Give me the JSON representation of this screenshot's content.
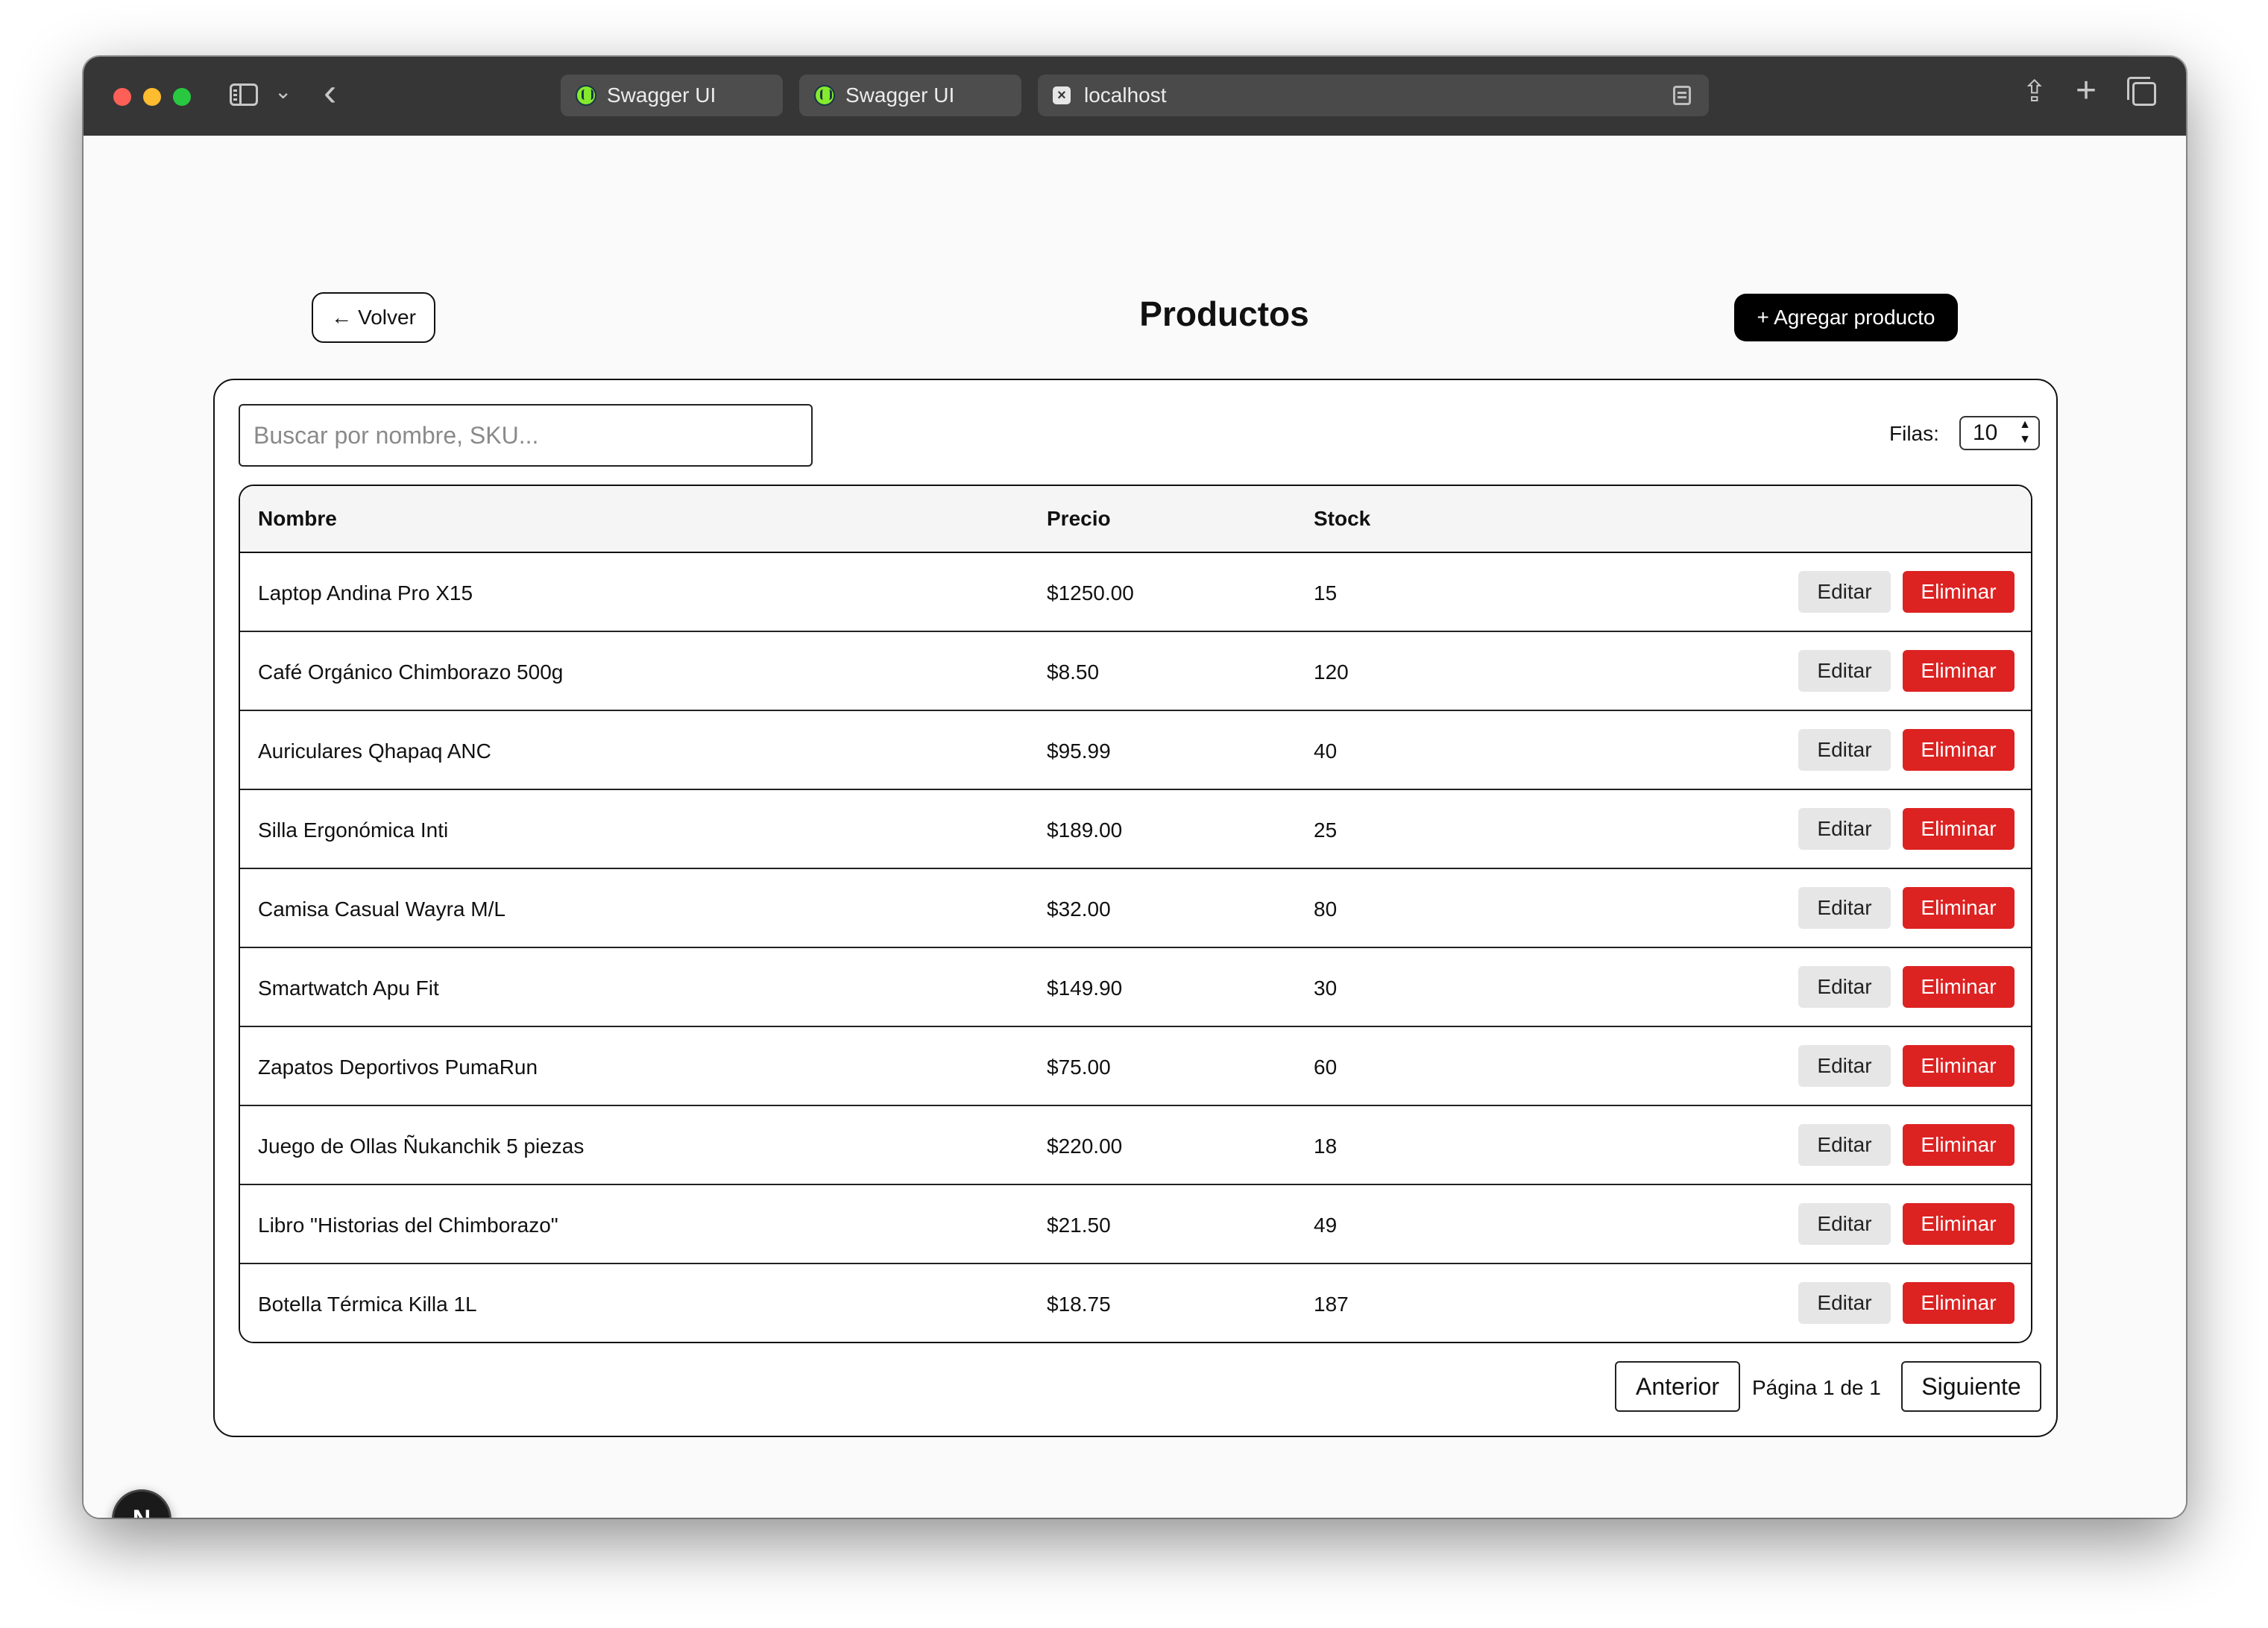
{
  "browser": {
    "tabs": [
      {
        "label": "Swagger UI"
      },
      {
        "label": "Swagger UI"
      },
      {
        "label": "localhost"
      }
    ]
  },
  "header": {
    "back_label": "Volver",
    "title": "Productos",
    "add_label": "+ Agregar producto"
  },
  "search": {
    "placeholder": "Buscar por nombre, SKU..."
  },
  "rows_control": {
    "label": "Filas:",
    "value": "10"
  },
  "table": {
    "columns": [
      "Nombre",
      "Precio",
      "Stock"
    ],
    "rows": [
      {
        "name": "Laptop Andina Pro X15",
        "price": "$1250.00",
        "stock": "15"
      },
      {
        "name": "Café Orgánico Chimborazo 500g",
        "price": "$8.50",
        "stock": "120"
      },
      {
        "name": "Auriculares Qhapaq ANC",
        "price": "$95.99",
        "stock": "40"
      },
      {
        "name": "Silla Ergonómica Inti",
        "price": "$189.00",
        "stock": "25"
      },
      {
        "name": "Camisa Casual Wayra M/L",
        "price": "$32.00",
        "stock": "80"
      },
      {
        "name": "Smartwatch Apu Fit",
        "price": "$149.90",
        "stock": "30"
      },
      {
        "name": "Zapatos Deportivos PumaRun",
        "price": "$75.00",
        "stock": "60"
      },
      {
        "name": "Juego de Ollas Ñukanchik 5 piezas",
        "price": "$220.00",
        "stock": "18"
      },
      {
        "name": "Libro \"Historias del Chimborazo\"",
        "price": "$21.50",
        "stock": "49"
      },
      {
        "name": "Botella Térmica Killa 1L",
        "price": "$18.75",
        "stock": "187"
      }
    ],
    "edit_label": "Editar",
    "delete_label": "Eliminar"
  },
  "pagination": {
    "prev_label": "Anterior",
    "info": "Página 1 de 1",
    "next_label": "Siguiente"
  },
  "dev_badge": {
    "letter": "N"
  },
  "colors": {
    "delete": "#dd2222",
    "primary": "#000000",
    "edit_bg": "#e6e6e6"
  }
}
